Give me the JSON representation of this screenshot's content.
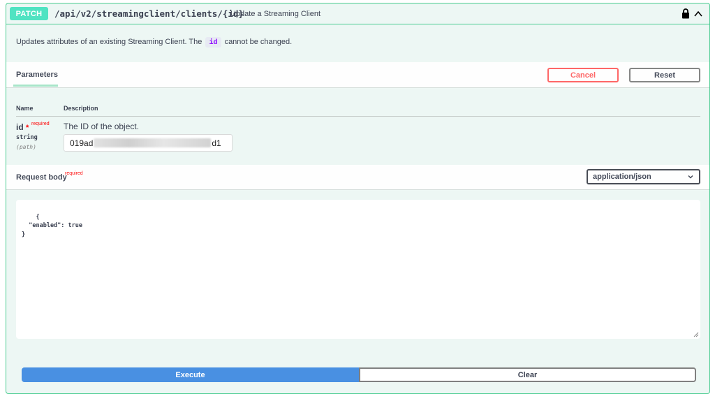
{
  "operation": {
    "method": "PATCH",
    "path": "/api/v2/streamingclient/clients/{id}",
    "summary": "Update a Streaming Client",
    "description_before": "Updates attributes of an existing Streaming Client. The",
    "description_code": "id",
    "description_after": "cannot be changed."
  },
  "parameters": {
    "tab_label": "Parameters",
    "cancel_label": "Cancel",
    "reset_label": "Reset",
    "col_name": "Name",
    "col_description": "Description",
    "items": [
      {
        "name": "id",
        "star": "*",
        "required": "required",
        "type": "string",
        "in": "(path)",
        "description": "The ID of the object.",
        "value_prefix": "019ad",
        "value_suffix": "d1"
      }
    ]
  },
  "request_body": {
    "title": "Request body",
    "required": "required",
    "content_type": "application/json",
    "json": "{\n  \"enabled\": true\n}"
  },
  "actions": {
    "execute_label": "Execute",
    "clear_label": "Clear"
  },
  "colors": {
    "method_bg": "#50e3c2",
    "border": "#49cc90",
    "panel_bg": "#edf7f4",
    "execute": "#4990e2",
    "cancel": "#ff6060"
  },
  "icons": {
    "lock": "lock-icon",
    "collapse": "chevron-up-icon",
    "dropdown": "chevron-down-icon"
  }
}
